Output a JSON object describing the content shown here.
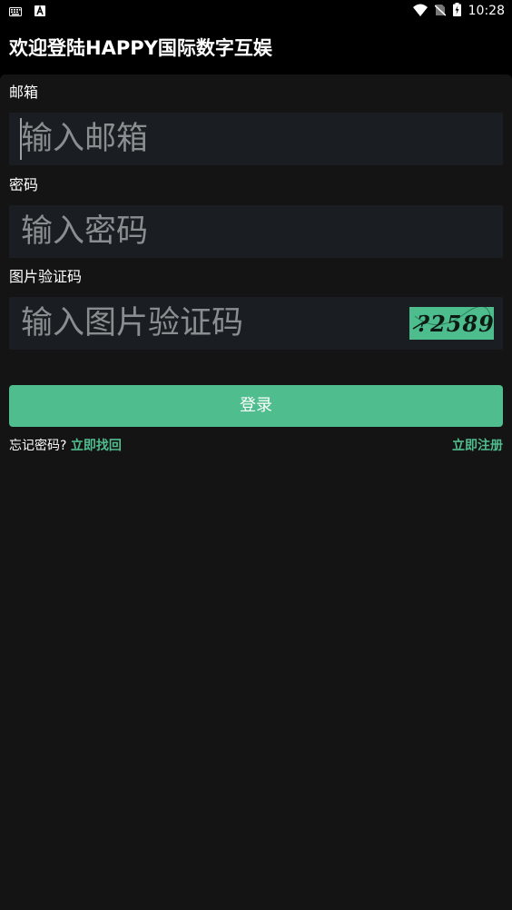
{
  "status_bar": {
    "time": "10:28",
    "icons": [
      "keyboard-icon",
      "a-notification-icon",
      "wifi-icon",
      "no-sim-icon",
      "battery-charging-icon"
    ]
  },
  "app_bar": {
    "title": "欢迎登陆HAPPY国际数字互娱"
  },
  "form": {
    "email": {
      "label": "邮箱",
      "placeholder": "输入邮箱"
    },
    "password": {
      "label": "密码",
      "placeholder": "输入密码"
    },
    "captcha": {
      "label": "图片验证码",
      "placeholder": "输入图片验证码",
      "image_text": "?2589"
    },
    "login_label": "登录",
    "forgot_prefix": "忘记密码?",
    "forgot_link": "立即找回",
    "register_link": "立即注册"
  },
  "colors": {
    "accent": "#4fbd8d",
    "background": "#151415",
    "field_background": "#1a1e22",
    "placeholder": "#8b8e91"
  }
}
